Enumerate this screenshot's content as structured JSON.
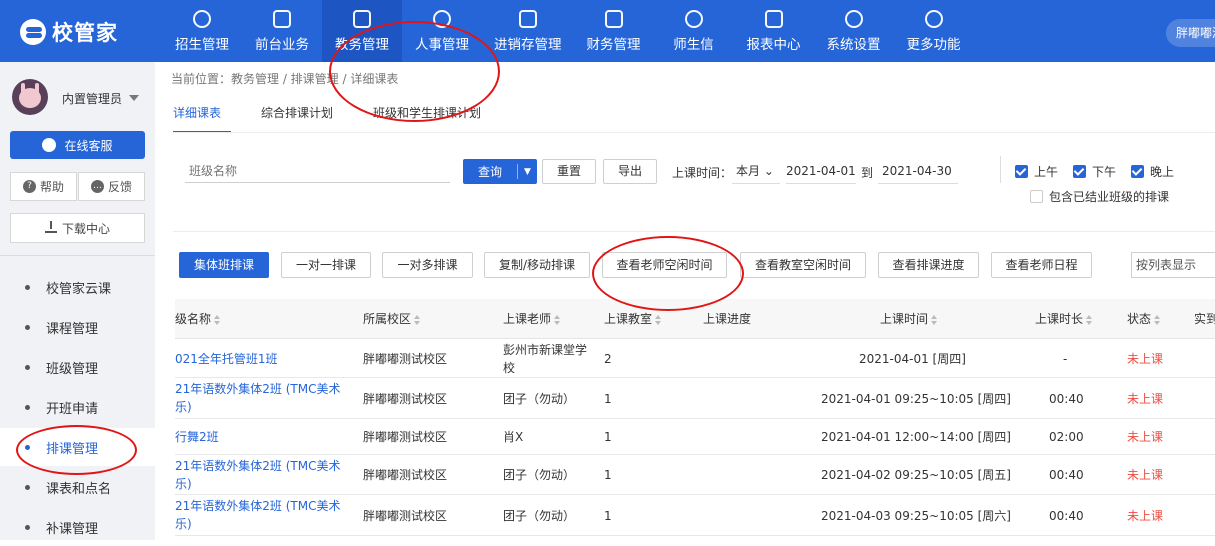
{
  "app": {
    "logo_text": "校管家",
    "user_name": "胖嘟嘟测试校区"
  },
  "nav": [
    {
      "label": "招生管理"
    },
    {
      "label": "前台业务"
    },
    {
      "label": "教务管理"
    },
    {
      "label": "人事管理"
    },
    {
      "label": "进销存管理"
    },
    {
      "label": "财务管理"
    },
    {
      "label": "师生信"
    },
    {
      "label": "报表中心"
    },
    {
      "label": "系统设置"
    },
    {
      "label": "更多功能"
    }
  ],
  "sidebar": {
    "admin_name": "内置管理员",
    "online_service": "在线客服",
    "help": "帮助",
    "feedback": "反馈",
    "download_center": "下载中心",
    "items": [
      {
        "label": "校管家云课"
      },
      {
        "label": "课程管理"
      },
      {
        "label": "班级管理"
      },
      {
        "label": "开班申请"
      },
      {
        "label": "排课管理"
      },
      {
        "label": "课表和点名"
      },
      {
        "label": "补课管理"
      }
    ]
  },
  "breadcrumb": "当前位置：教务管理 / 排课管理 / 详细课表",
  "tabs": [
    {
      "label": "详细课表"
    },
    {
      "label": "综合排课计划"
    },
    {
      "label": "班级和学生排课计划"
    }
  ],
  "filters": {
    "class_placeholder": "班级名称",
    "query": "查询",
    "reset": "重置",
    "export": "导出",
    "time_label": "上课时间：",
    "month": "本月",
    "start_date": "2021-04-01",
    "to": "到",
    "end_date": "2021-04-30",
    "morning": "上午",
    "afternoon": "下午",
    "evening": "晚上",
    "include_finished": "包含已结业班级的排课"
  },
  "actions": {
    "group_schedule": "集体班排课",
    "one_to_one": "一对一排课",
    "one_to_many": "一对多排课",
    "copy_move": "复制/移动排课",
    "teacher_free": "查看老师空闲时间",
    "room_free": "查看教室空闲时间",
    "progress": "查看排课进度",
    "teacher_schedule": "查看老师日程",
    "display_mode": "按列表显示"
  },
  "table": {
    "headers": {
      "class_name": "级名称",
      "campus": "所属校区",
      "teacher": "上课老师",
      "room": "上课教室",
      "progress": "上课进度",
      "time": "上课时间",
      "duration": "上课时长",
      "status": "状态",
      "actual": "实到"
    },
    "rows": [
      {
        "class_name": "021全年托管班1班",
        "campus": "胖嘟嘟测试校区",
        "teacher": "彭州市新课堂学校",
        "room": "2",
        "time": "2021-04-01 [周四]",
        "duration": "-",
        "status": "未上课"
      },
      {
        "class_name": "21年语数外集体2班 (TMC美术乐)",
        "campus": "胖嘟嘟测试校区",
        "teacher": "团子（勿动）",
        "room": "1",
        "time": "2021-04-01 09:25~10:05 [周四]",
        "duration": "00:40",
        "status": "未上课"
      },
      {
        "class_name": "行舞2班",
        "campus": "胖嘟嘟测试校区",
        "teacher": "肖X",
        "room": "1",
        "time": "2021-04-01 12:00~14:00 [周四]",
        "duration": "02:00",
        "status": "未上课"
      },
      {
        "class_name": "21年语数外集体2班 (TMC美术乐)",
        "campus": "胖嘟嘟测试校区",
        "teacher": "团子（勿动）",
        "room": "1",
        "time": "2021-04-02 09:25~10:05 [周五]",
        "duration": "00:40",
        "status": "未上课"
      },
      {
        "class_name": "21年语数外集体2班 (TMC美术乐)",
        "campus": "胖嘟嘟测试校区",
        "teacher": "团子（勿动）",
        "room": "1",
        "time": "2021-04-03 09:25~10:05 [周六]",
        "duration": "00:40",
        "status": "未上课"
      }
    ]
  },
  "colors": {
    "brand": "#2565d8",
    "status_pending": "#ef4d43",
    "annotation": "#e01616"
  }
}
